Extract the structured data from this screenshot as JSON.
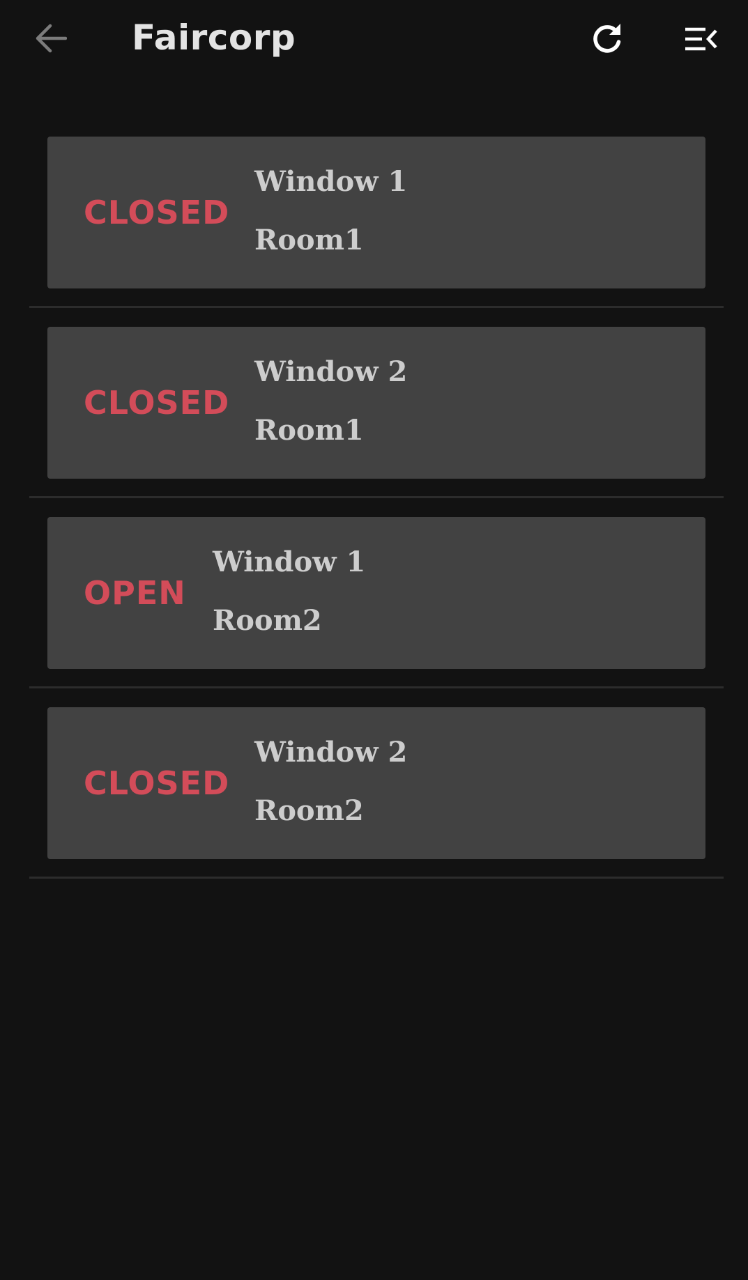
{
  "app_bar": {
    "title": "Faircorp",
    "back_icon": "arrow-left-icon",
    "refresh_icon": "refresh-icon",
    "menu_icon": "menu-collapse-icon"
  },
  "windows": [
    {
      "status": "CLOSED",
      "name": "Window 1",
      "room": "Room1"
    },
    {
      "status": "CLOSED",
      "name": "Window 2",
      "room": "Room1"
    },
    {
      "status": "OPEN",
      "name": "Window 1",
      "room": "Room2"
    },
    {
      "status": "CLOSED",
      "name": "Window 2",
      "room": "Room2"
    }
  ],
  "colors": {
    "background": "#121212",
    "card": "#424242",
    "status": "#d34c59",
    "text": "#cdcdcd",
    "title": "#e3e3e3",
    "divider": "#2c2c2c"
  }
}
